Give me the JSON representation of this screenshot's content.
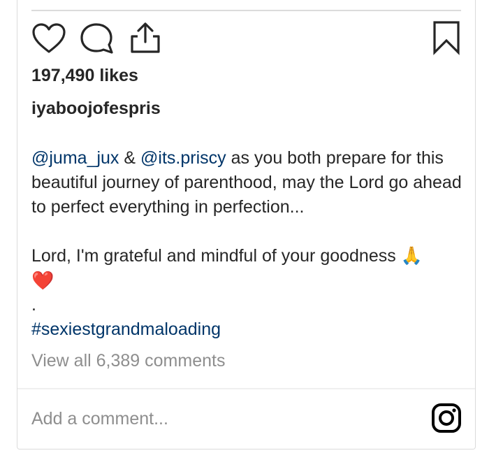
{
  "post": {
    "likes": "197,490 likes",
    "username": "iyaboojofespris",
    "caption": {
      "mention_1": "@juma_jux",
      "joiner": " & ",
      "mention_2": "@its.priscy",
      "line_1_rest": " as you both prepare for this beautiful journey of parenthood, may the Lord go ahead to perfect everything in perfection...",
      "line_2": "Lord, I'm grateful and mindful of your goodness 🙏",
      "emoji_heart": "❤️",
      "dot": ".",
      "hashtag": "#sexiestgrandmaloading"
    },
    "view_comments": "View all 6,389 comments"
  },
  "actions": {
    "like_icon": "heart-outline-icon",
    "comment_icon": "comment-bubble-icon",
    "share_icon": "share-upload-icon",
    "save_icon": "bookmark-icon"
  },
  "comment_box": {
    "placeholder": "Add a comment...",
    "icon": "instagram-logo-icon"
  },
  "colors": {
    "text": "#262626",
    "muted": "#8e8e8e",
    "link": "#003569",
    "border": "#dbdbdb"
  }
}
